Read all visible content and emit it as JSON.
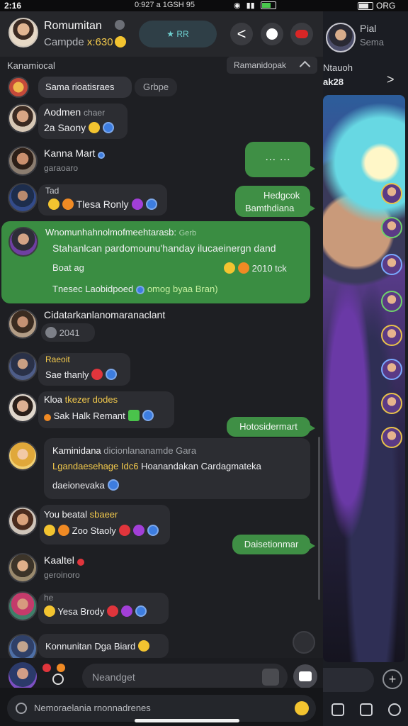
{
  "status_bar": {
    "time": "2:16",
    "center_text": "0:927 a 1GSH 95",
    "right_text": "ORG"
  },
  "header": {
    "title": "Romumitan",
    "subtitle": "Campde",
    "subtitle_tail": "x:630",
    "pill_label": "★ RR",
    "back_glyph": "<"
  },
  "subheader": {
    "left": "Kanamiocal",
    "right": "Ramanidopak"
  },
  "messages": [
    {
      "id": "m0",
      "text": "Sama rioatisraes",
      "chip": "Grbpe"
    },
    {
      "id": "m1",
      "name": "Aodmen",
      "name_tail": "chaer",
      "line": "2a Saony"
    },
    {
      "id": "m2",
      "name": "Kanna Mart",
      "meta": "garaoaro"
    },
    {
      "id": "m3",
      "name": "Tad",
      "line": "Tlesa Ronly"
    },
    {
      "id": "m4",
      "name": "Wnomunhahnolmofmeehtarasb:",
      "name_tail": "Gerb",
      "line": "Stahanlcan pardomounu'handay ilucaeinergn dand",
      "left_meta": "Boat ag",
      "right_meta": "2010 tck",
      "footer": "Tnesec Laobidpoed",
      "footer_tail": "omog byaa Bran)"
    },
    {
      "id": "m5",
      "name": "Cidatarkanlanomaranaclant",
      "line": "2041"
    },
    {
      "id": "m6",
      "name": "Raeoit",
      "line": "Sae thanly"
    },
    {
      "id": "m7",
      "name": "Kloa",
      "name_tail": "tkezer dodes",
      "line": "Sak Halk Remant"
    },
    {
      "id": "m8",
      "name": "Kaminidana",
      "name_tail": "dicionlananamde Gara",
      "line_yellow": "Lgandaesehage Idc6",
      "line_rest": "Hoanandakan Cardagmateka",
      "line2": "daeionevaka"
    },
    {
      "id": "m9",
      "name": "You beatal",
      "name_tail": "sbaeer",
      "line": "Zoo Staoly"
    },
    {
      "id": "m10",
      "name": "Kaaltel",
      "meta": "geroinoro"
    },
    {
      "id": "m11",
      "name": "he",
      "line": "Yesa Brody"
    },
    {
      "id": "m12",
      "name": "Konnunitan Dga Biard"
    }
  ],
  "outgoing": {
    "o1": "…   …",
    "o2_line1": "Hedgcok",
    "o2_line2": "Bamthdiana",
    "o3": "Hotosidermart",
    "o4": "Daisetionmar"
  },
  "composer": {
    "placeholder": "Neandget",
    "bottom_text": "Nemoraelania rnonnadrenes"
  },
  "side": {
    "name": "Pial",
    "sub": "Sema",
    "h1": "Ntauoh",
    "h2": "ak28",
    "arrow": ">"
  }
}
